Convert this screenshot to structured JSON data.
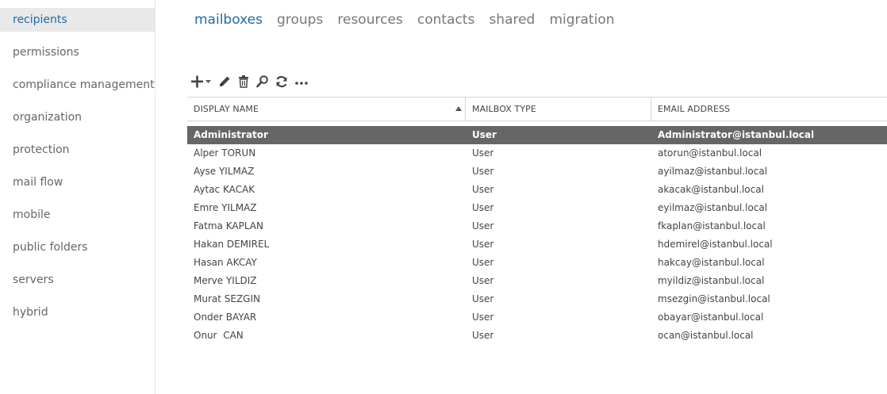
{
  "sidebar": {
    "items": [
      {
        "label": "recipients",
        "active": true
      },
      {
        "label": "permissions"
      },
      {
        "label": "compliance management"
      },
      {
        "label": "organization"
      },
      {
        "label": "protection"
      },
      {
        "label": "mail flow"
      },
      {
        "label": "mobile"
      },
      {
        "label": "public folders"
      },
      {
        "label": "servers"
      },
      {
        "label": "hybrid"
      }
    ]
  },
  "tabs": [
    {
      "label": "mailboxes",
      "active": true
    },
    {
      "label": "groups"
    },
    {
      "label": "resources"
    },
    {
      "label": "contacts"
    },
    {
      "label": "shared"
    },
    {
      "label": "migration"
    }
  ],
  "toolbar": {
    "icons": [
      "add-icon",
      "edit-icon",
      "delete-icon",
      "search-icon",
      "refresh-icon",
      "more-icon"
    ]
  },
  "table": {
    "columns": [
      "DISPLAY NAME",
      "MAILBOX TYPE",
      "EMAIL ADDRESS"
    ],
    "sorted_column": "DISPLAY NAME",
    "sort_direction": "ascending",
    "rows": [
      {
        "name": "Administrator",
        "type": "User",
        "email": "Administrator@istanbul.local",
        "selected": true
      },
      {
        "name": "Alper TORUN",
        "type": "User",
        "email": "atorun@istanbul.local"
      },
      {
        "name": "Ayse YILMAZ",
        "type": "User",
        "email": "ayilmaz@istanbul.local"
      },
      {
        "name": "Aytac KACAK",
        "type": "User",
        "email": "akacak@istanbul.local"
      },
      {
        "name": "Emre YILMAZ",
        "type": "User",
        "email": "eyilmaz@istanbul.local"
      },
      {
        "name": "Fatma KAPLAN",
        "type": "User",
        "email": "fkaplan@istanbul.local"
      },
      {
        "name": "Hakan DEMIREL",
        "type": "User",
        "email": "hdemirel@istanbul.local"
      },
      {
        "name": "Hasan AKCAY",
        "type": "User",
        "email": "hakcay@istanbul.local"
      },
      {
        "name": "Merve YILDIZ",
        "type": "User",
        "email": "myildiz@istanbul.local"
      },
      {
        "name": "Murat SEZGIN",
        "type": "User",
        "email": "msezgin@istanbul.local"
      },
      {
        "name": "Onder BAYAR",
        "type": "User",
        "email": "obayar@istanbul.local"
      },
      {
        "name": "Onur  CAN",
        "type": "User",
        "email": "ocan@istanbul.local"
      }
    ]
  },
  "colors": {
    "accent": "#1f6aa5",
    "selected_row": "#666666",
    "sidebar_active_bg": "#e9e9e9"
  }
}
